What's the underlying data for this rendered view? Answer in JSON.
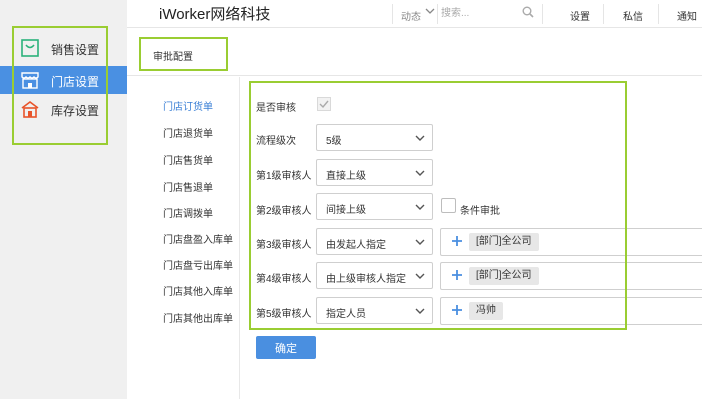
{
  "app": {
    "brand": "iWorker网络科技"
  },
  "header": {
    "dynamic_label": "动态",
    "search_placeholder": "搜索...",
    "links": [
      "设置",
      "私信",
      "通知"
    ]
  },
  "sidebar": {
    "items": [
      {
        "label": "销售设置",
        "icon": "shopping-bag-icon",
        "active": false
      },
      {
        "label": "门店设置",
        "icon": "store-icon",
        "active": true
      },
      {
        "label": "库存设置",
        "icon": "warehouse-icon",
        "active": false
      }
    ]
  },
  "tab": {
    "label": "审批配置"
  },
  "subnav": {
    "items": [
      "门店订货单",
      "门店退货单",
      "门店售货单",
      "门店售退单",
      "门店调拨单",
      "门店盘盈入库单",
      "门店盘亏出库单",
      "门店其他入库单",
      "门店其他出库单"
    ],
    "active_index": 0
  },
  "form": {
    "need_approval_label": "是否审核",
    "levels_label": "流程级次",
    "levels_value": "5级",
    "approvers": [
      {
        "label": "第1级审核人",
        "value": "直接上级"
      },
      {
        "label": "第2级审核人",
        "value": "间接上级"
      },
      {
        "label": "第3级审核人",
        "value": "由发起人指定",
        "tag": "[部门]全公司"
      },
      {
        "label": "第4级审核人",
        "value": "由上级审核人指定",
        "tag": "[部门]全公司"
      },
      {
        "label": "第5级审核人",
        "value": "指定人员",
        "tag": "冯帅"
      }
    ],
    "conditional_label": "条件审批",
    "confirm_label": "确定"
  },
  "colors": {
    "accent": "#4a90e2",
    "highlight_box": "#9acd32"
  }
}
